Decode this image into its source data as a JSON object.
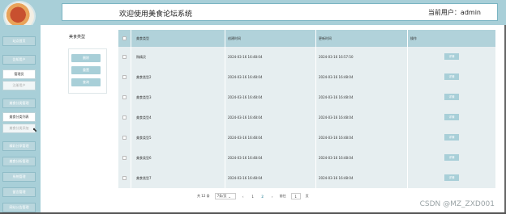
{
  "header": {
    "title": "欢迎使用美食论坛系统",
    "current_user": "当前用户：admin"
  },
  "sidebar": {
    "items": [
      {
        "label": "站点首页",
        "style": "main"
      },
      {
        "label": "告知用户",
        "style": "main"
      },
      {
        "label": "管理员",
        "style": "sub"
      },
      {
        "label": "注册用户",
        "style": "sub-dim"
      },
      {
        "label": "美食分类管理",
        "style": "main"
      },
      {
        "label": "美食分类列表",
        "style": "sub"
      },
      {
        "label": "美食分类添加",
        "style": "sub-dim"
      },
      {
        "label": "精彩分享管理",
        "style": "main"
      },
      {
        "label": "美食分析管理",
        "style": "main"
      },
      {
        "label": "系统管理",
        "style": "main"
      },
      {
        "label": "留言管理",
        "style": "main"
      },
      {
        "label": "网站公告管理",
        "style": "main"
      }
    ]
  },
  "filter": {
    "label": "美食类型",
    "buttons": [
      "删除",
      "重置",
      "查询"
    ]
  },
  "table": {
    "headers": [
      "美食类型",
      "创建时间",
      "更新时间",
      "操作"
    ],
    "rows": [
      {
        "type": "购精灵",
        "created": "2024-03-16 16:48:04",
        "updated": "2024-03-16 16:57:50",
        "action": "详情"
      },
      {
        "type": "美食类型2",
        "created": "2024-03-16 16:48:04",
        "updated": "2024-03-16 16:48:04",
        "action": "详情"
      },
      {
        "type": "美食类型3",
        "created": "2024-03-16 16:48:04",
        "updated": "2024-03-16 16:48:04",
        "action": "详情"
      },
      {
        "type": "美食类型4",
        "created": "2024-03-16 16:48:04",
        "updated": "2024-03-16 16:48:04",
        "action": "详情"
      },
      {
        "type": "美食类型5",
        "created": "2024-03-16 16:48:04",
        "updated": "2024-03-16 16:48:04",
        "action": "详情"
      },
      {
        "type": "美食类型6",
        "created": "2024-03-16 16:48:04",
        "updated": "2024-03-16 16:48:04",
        "action": "详情"
      },
      {
        "type": "美食类型7",
        "created": "2024-03-16 16:48:04",
        "updated": "2024-03-16 16:48:04",
        "action": "详情"
      }
    ]
  },
  "pagination": {
    "total": "共 12 条",
    "page_size": "7条/页",
    "prev": "‹",
    "pages": [
      "1",
      "2"
    ],
    "active_page": "2",
    "next": "›",
    "goto_label": "前往",
    "goto_value": "1",
    "goto_suffix": "页"
  },
  "watermark": "CSDN @MZ_ZXD001",
  "colors": {
    "accent": "#a8cfd8",
    "table_header": "#b1d2da",
    "table_body": "#e6eef0"
  }
}
